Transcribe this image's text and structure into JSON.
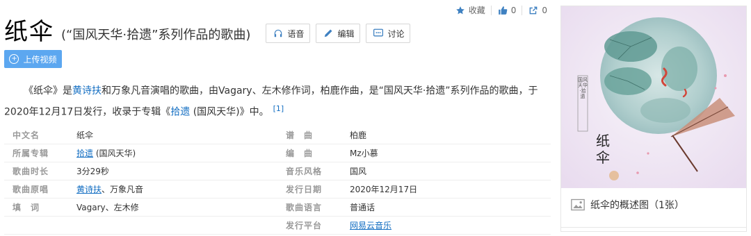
{
  "topbar": {
    "favorite_label": "收藏",
    "like_count": "0",
    "share_count": "0"
  },
  "header": {
    "title": "纸伞",
    "subtitle": "(“国风天华·拾遗”系列作品的歌曲)",
    "actions": [
      {
        "label": "语音",
        "icon": "headphones-icon"
      },
      {
        "label": "编辑",
        "icon": "pencil-icon"
      },
      {
        "label": "讨论",
        "icon": "chat-icon"
      }
    ],
    "upload_label": "上传视频"
  },
  "summary": {
    "p1": "《纸伞》是",
    "link_artist": "黄诗扶",
    "p2": "和万象凡音演唱的歌曲，由Vagary、左木修作词，柏鹿作曲，是“国风天华·拾遗”系列作品的歌曲，于2020年12月17日发行，收录于专辑《",
    "link_album": "拾遗",
    "p3": " (国风天华)》中。",
    "ref": "[1]"
  },
  "info": {
    "left": [
      {
        "label": "中文名",
        "value": "纸伞"
      },
      {
        "label": "所属专辑",
        "link": "拾遗",
        "value": " (国风天华)"
      },
      {
        "label": "歌曲时长",
        "value": "3分29秒"
      },
      {
        "label": "歌曲原唱",
        "link": "黄诗扶",
        "value": "、万象凡音"
      },
      {
        "label": "填　词",
        "value": "Vagary、左木修"
      }
    ],
    "right": [
      {
        "label": "谱　曲",
        "value": "柏鹿"
      },
      {
        "label": "编　曲",
        "value": "Mz小慕"
      },
      {
        "label": "音乐风格",
        "value": "国风"
      },
      {
        "label": "发行日期",
        "value": "2020年12月17日"
      },
      {
        "label": "歌曲语言",
        "value": "普通话"
      },
      {
        "label": "发行平台",
        "link": "网易云音乐"
      }
    ]
  },
  "sidebar": {
    "caption": "纸伞的概述图（1张）",
    "cover_title": "纸 伞",
    "cover_stamp": "国风天华·拾遗"
  },
  "colors": {
    "link": "#136ec2",
    "accent": "#3f81c1",
    "upload_bg": "#5ca7f0"
  }
}
